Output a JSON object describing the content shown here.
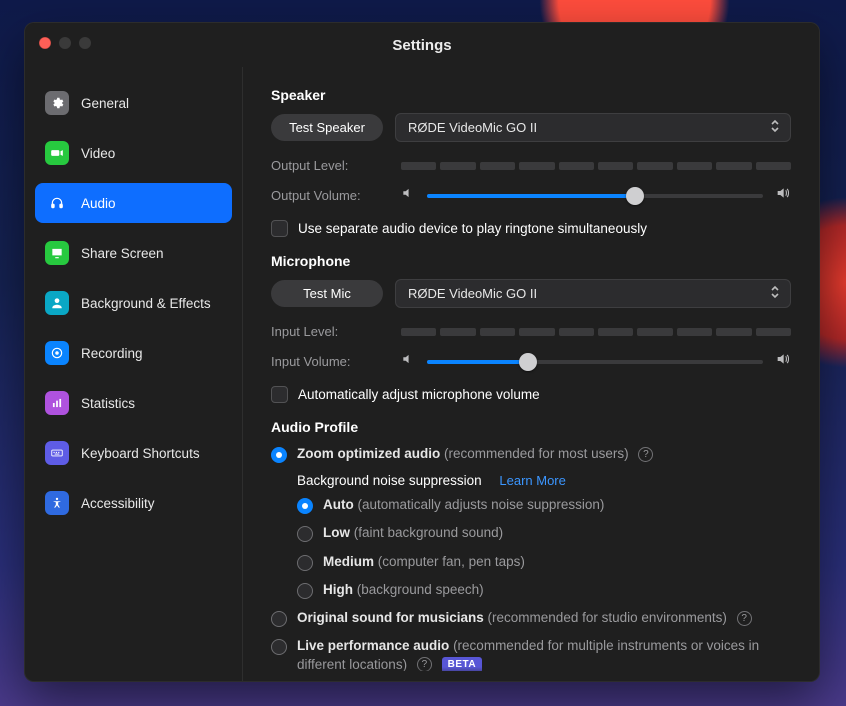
{
  "window": {
    "title": "Settings"
  },
  "sidebar": {
    "items": [
      {
        "label": "General"
      },
      {
        "label": "Video"
      },
      {
        "label": "Audio"
      },
      {
        "label": "Share Screen"
      },
      {
        "label": "Background & Effects"
      },
      {
        "label": "Recording"
      },
      {
        "label": "Statistics"
      },
      {
        "label": "Keyboard Shortcuts"
      },
      {
        "label": "Accessibility"
      }
    ],
    "active_index": 2
  },
  "speaker": {
    "heading": "Speaker",
    "test_label": "Test Speaker",
    "device": "RØDE VideoMic GO II",
    "output_level_label": "Output Level:",
    "output_volume_label": "Output Volume:",
    "output_volume_pct": 62,
    "ringtone_checkbox": "Use separate audio device to play ringtone simultaneously"
  },
  "microphone": {
    "heading": "Microphone",
    "test_label": "Test Mic",
    "device": "RØDE VideoMic GO II",
    "input_level_label": "Input Level:",
    "input_volume_label": "Input Volume:",
    "input_volume_pct": 30,
    "auto_adjust_checkbox": "Automatically adjust microphone volume"
  },
  "profile": {
    "heading": "Audio Profile",
    "zoom_optimized": {
      "label": "Zoom optimized audio",
      "hint": "(recommended for most users)"
    },
    "bg_heading": "Background noise suppression",
    "learn_more": "Learn More",
    "options": {
      "auto": {
        "label": "Auto",
        "hint": "(automatically adjusts noise suppression)"
      },
      "low": {
        "label": "Low",
        "hint": "(faint background sound)"
      },
      "medium": {
        "label": "Medium",
        "hint": "(computer fan, pen taps)"
      },
      "high": {
        "label": "High",
        "hint": "(background speech)"
      }
    },
    "original_sound": {
      "label": "Original sound for musicians",
      "hint": "(recommended for studio environments)"
    },
    "live_perf": {
      "label": "Live performance audio",
      "hint": "(recommended for multiple instruments or voices in different locations)",
      "beta": "BETA"
    }
  }
}
